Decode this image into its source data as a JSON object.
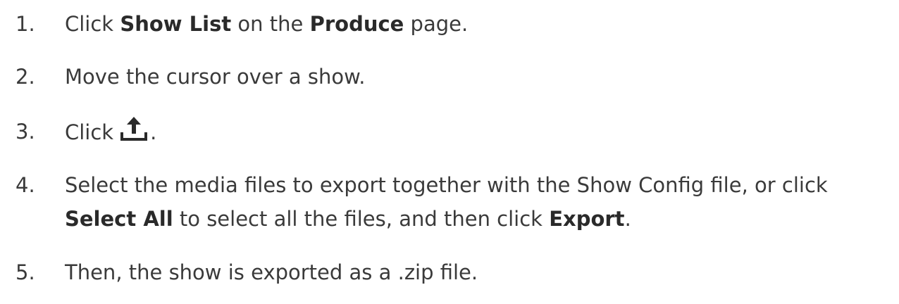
{
  "steps": [
    {
      "number": "1.",
      "t1": "Click ",
      "b1": "Show List",
      "t2": " on the ",
      "b2": "Produce",
      "t3": " page."
    },
    {
      "number": "2.",
      "t1": "Move the cursor over a show."
    },
    {
      "number": "3.",
      "t1": "Click",
      "icon": "export-upload-icon",
      "t2": "."
    },
    {
      "number": "4.",
      "t1": "Select the media files to export together with the Show Config file, or click",
      "b1": "Select All",
      "t2": " to select all the files, and then click ",
      "b2": "Export",
      "t3": "."
    },
    {
      "number": "5.",
      "t1": "Then, the show is exported as a .zip file."
    }
  ],
  "colors": {
    "text": "#3a3a3a",
    "bold_text": "#2a2a2a",
    "icon": "#2a2a2a",
    "background": "#ffffff"
  }
}
